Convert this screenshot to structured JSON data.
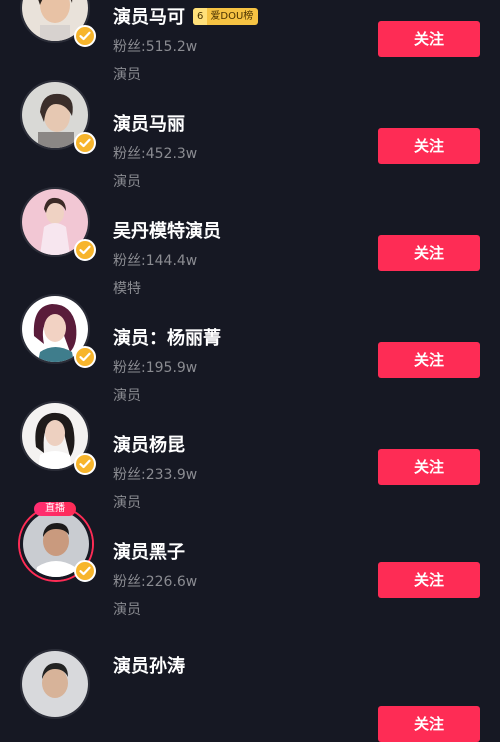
{
  "follow_label": "关注",
  "live_badge": "直播",
  "accounts": [
    {
      "name": "演员马可",
      "rank_num": "6",
      "rank_label": "爱DOU榜",
      "fans": "粉丝:515.2w",
      "desc": "演员",
      "avatar": "avatar-photo"
    },
    {
      "name": "演员马丽",
      "fans": "粉丝:452.3w",
      "desc": "演员",
      "avatar": "avatar-photo"
    },
    {
      "name": "吴丹模特演员",
      "fans": "粉丝:144.4w",
      "desc": "模特",
      "avatar": "avatar-photo"
    },
    {
      "name": "演员：杨丽菁",
      "fans": "粉丝:195.9w",
      "desc": "演员",
      "avatar": "avatar-photo"
    },
    {
      "name": "演员杨昆",
      "fans": "粉丝:233.9w",
      "desc": "演员",
      "avatar": "avatar-photo"
    },
    {
      "name": "演员黑子",
      "fans": "粉丝:226.6w",
      "desc": "演员",
      "avatar": "avatar-photo",
      "live": true
    },
    {
      "name": "演员孙涛",
      "fans": "",
      "desc": "",
      "avatar": "avatar-photo"
    }
  ],
  "colors": {
    "background": "#161823",
    "accent": "#fe2c55",
    "verified": "#f7b52c",
    "secondary_text": "#8a8b91"
  }
}
